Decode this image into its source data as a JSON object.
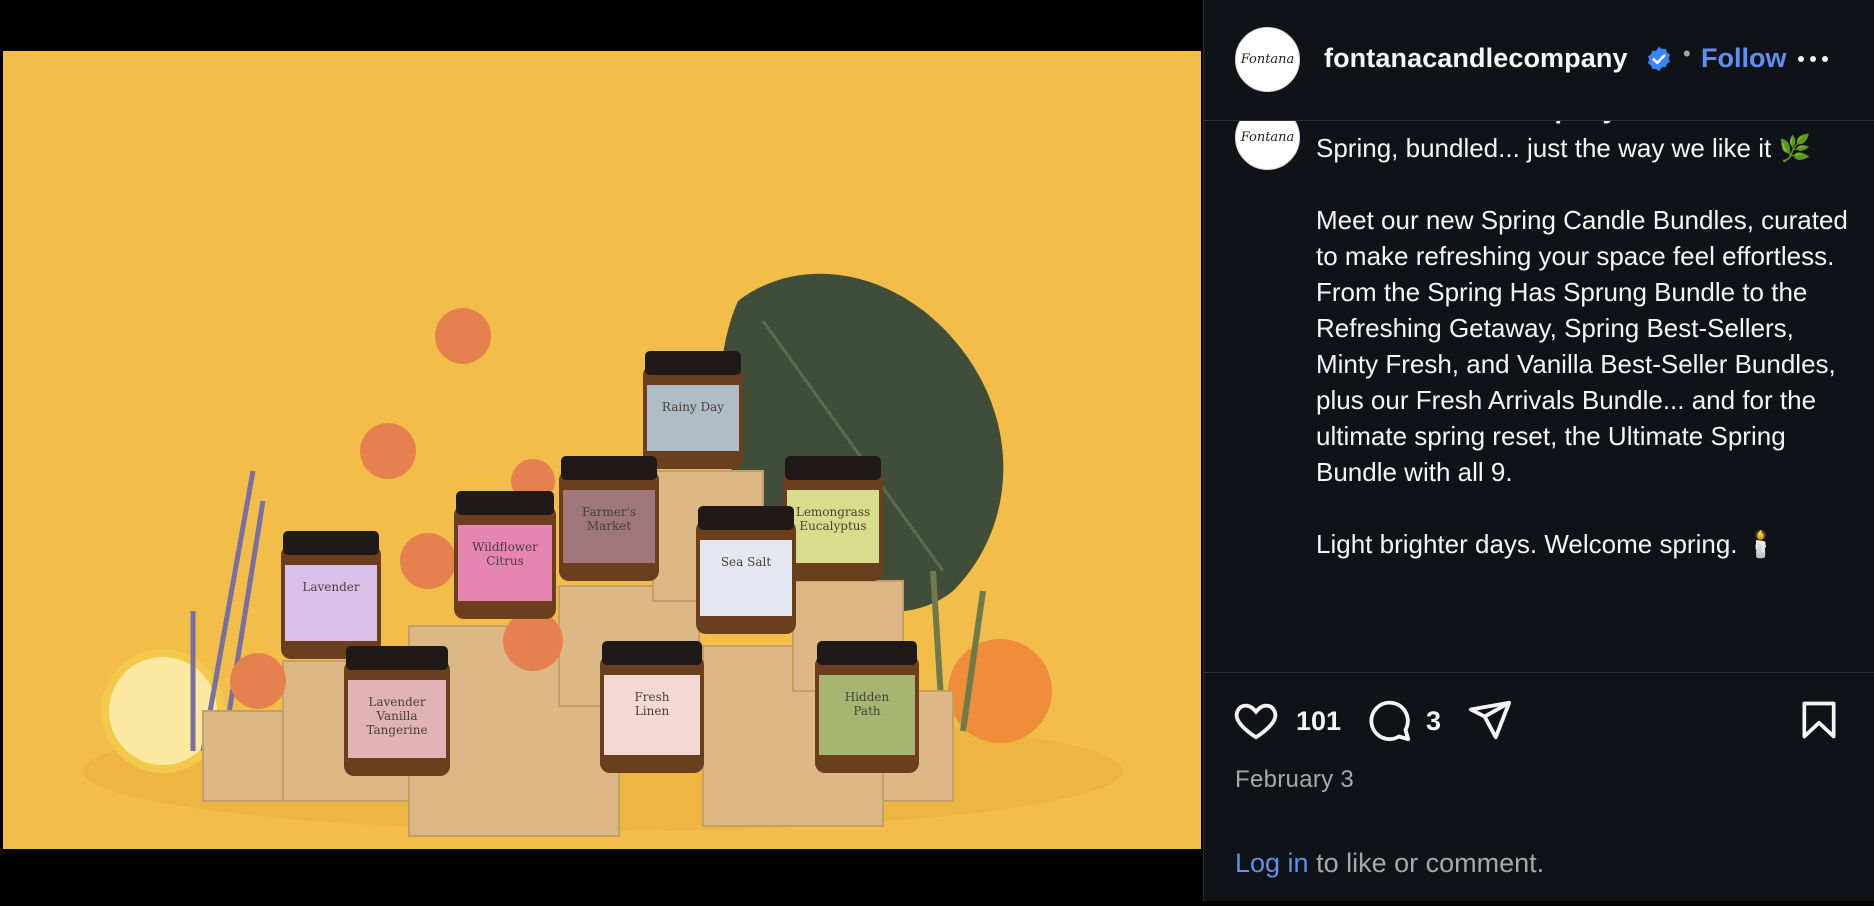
{
  "post": {
    "username": "fontanacandlecompany",
    "avatar_logo_text": "Fontana",
    "separator": "•",
    "follow_label": "Follow",
    "caption": "Spring, bundled... just the way we like it 🌿\n\nMeet our new Spring Candle Bundles, curated to make refreshing your space feel effortless.\nFrom the Spring Has Sprung Bundle to the Refreshing Getaway, Spring Best-Sellers, Minty Fresh, and Vanilla Best-Seller Bundles, plus our Fresh Arrivals Bundle... and for the ultimate spring reset, the Ultimate Spring Bundle with all 9.\n\nLight brighter days. Welcome spring. 🕯️"
  },
  "actions": {
    "like_icon": "heart-icon",
    "like_count": "101",
    "comment_icon": "comment-icon",
    "comment_count": "3",
    "share_icon": "share-icon",
    "save_icon": "bookmark-icon",
    "date": "February 3"
  },
  "footer": {
    "login_link": "Log in",
    "login_rest": " to like or comment."
  },
  "photo": {
    "background_color": "#f2bd48",
    "jars": [
      {
        "label": "Rainy Day",
        "color": "#aebdc6"
      },
      {
        "label": "Farmer's Market",
        "color": "#9e767c"
      },
      {
        "label": "Lemongrass Eucalyptus",
        "color": "#d6de8c"
      },
      {
        "label": "Wildflower Citrus",
        "color": "#e684b2"
      },
      {
        "label": "Sea Salt",
        "color": "#e4e7ef"
      },
      {
        "label": "Lavender",
        "color": "#d9c1ea"
      },
      {
        "label": "Lavender Vanilla Tangerine",
        "color": "#dfb3b7"
      },
      {
        "label": "Fresh Linen",
        "color": "#f4d8d1"
      },
      {
        "label": "Hidden Path",
        "color": "#a6b572"
      }
    ]
  },
  "colors": {
    "accent": "#5f8ff0",
    "verified": "#3b84f5",
    "panel_bg": "#0f1317"
  }
}
